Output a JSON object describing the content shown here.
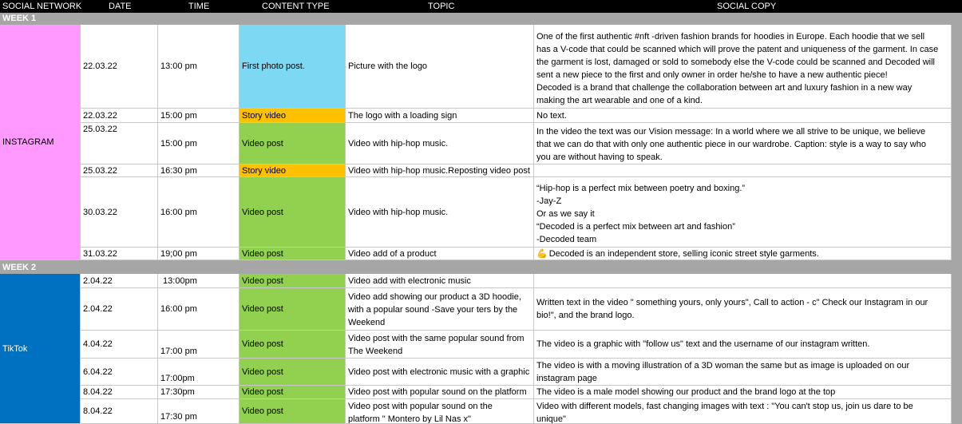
{
  "headers": {
    "network": "SOCIAL NETWORK",
    "date": "DATE",
    "time": "TIME",
    "content_type": "CONTENT TYPE",
    "topic": "TOPIC",
    "copy": "SOCIAL COPY"
  },
  "week1": "WEEK 1",
  "week2": "WEEK 2",
  "instagram": {
    "network": "INSTAGRAM",
    "rows": [
      {
        "date": "22.03.22",
        "time": "13:00 pm",
        "type": "First photo post.",
        "topic": "Picture with the logo",
        "copy": [
          "One of the first authentic #nft -driven fashion brands for hoodies in Europe. Each hoodie that we sell",
          "has a V-code that could be scanned which will prove the patent and uniqueness of the garment. In case",
          "the garment is lost, damaged or sold to somebody else the V-code could be scanned and Decoded will",
          "sent a new piece to the first and only owner in order he/she to have a new authentic piece!",
          "Decoded is a brand that challenge the collaboration between art and luxury fashion in a new way",
          "making the art wearable and one of a kind."
        ]
      },
      {
        "date": "22.03.22",
        "time": "15:00 pm",
        "type": "Story video",
        "topic": "The logo with a loading sign",
        "copy": [
          " No text."
        ]
      },
      {
        "date": "25.03.22",
        "time": "15:00 pm",
        "type": "Video post",
        "topic": "Video with hip-hop music.",
        "copy": [
          "In the video the text was our Vision message: In a world where we all strive to be unique, we believe",
          "that we can do that with only one authentic piece in our wardrobe. Caption: style is a way to say who",
          "you are without having to speak."
        ]
      },
      {
        "date": "25.03.22",
        "time": "16:30 pm",
        "type": "Story  video",
        "topic": "Video with hip-hop music.Reposting video post",
        "copy": [
          ""
        ]
      },
      {
        "date": "30.03.22",
        "time": "16:00 pm",
        "type": "Video post",
        "topic": "Video with hip-hop music.",
        "copy": [
          "“Hip-hop is a perfect mix between poetry and boxing.”",
          "-Jay-Z",
          "Or as we say it",
          "“Decoded is a perfect mix between art and fashion”",
          "-Decoded team"
        ]
      },
      {
        "date": "31.03.22",
        "time": "19;00 pm",
        "type": "Video post",
        "topic": "Video add of a product",
        "copy": [
          "Decoded is an independent store, selling iconic street style garments."
        ]
      }
    ]
  },
  "tiktok": {
    "network": "TikTok",
    "rows": [
      {
        "date": "2.04.22",
        "time": " 13:00pm",
        "type": "Video post",
        "topic": [
          "Video add with electronic music"
        ],
        "copy": [
          ""
        ]
      },
      {
        "date": "2.04.22",
        "time": "16:00 pm",
        "type": "Video post",
        "topic": [
          "Video add showing our product a 3D hoodie,",
          "with a popular sound -Save your ters by the",
          "Weekend"
        ],
        "copy": [
          "Written text in the video \" something yours, only yours\", Call to action - c\" Check our Instagram in our",
          "bio!\", and the brand logo."
        ]
      },
      {
        "date": "4.04.22",
        "time": "17:00 pm",
        "type": "Video post",
        "topic": [
          "Video post with the same popular sound from",
          "The Weekend"
        ],
        "copy": [
          "The video is a graphic with \"follow us\" text  and the username of our instagram written."
        ]
      },
      {
        "date": "6.04.22",
        "time": "17:00pm",
        "type": "Video post",
        "topic": [
          "Video post with electronic music with a graphic"
        ],
        "copy": [
          "The video is with a moving illustration of a 3D woman the same but as image is uploaded on our",
          "instagram page"
        ]
      },
      {
        "date": "8.04.22",
        "time": "17:30pm",
        "type": "Video post",
        "topic": [
          "Video post with popular sound on the platform"
        ],
        "copy": [
          "The video is a male model showing our product and the brand logo at the top"
        ]
      },
      {
        "date": "8.04.22",
        "time": "17:30 pm",
        "type": "Video post",
        "topic": [
          "Video post with popular sound on the",
          "platform \" Montero by Lil Nas x\""
        ],
        "copy": [
          "Video with different models, fast changing images with text : \"You can't stop us, join us dare to be",
          "unique\""
        ]
      }
    ]
  },
  "colors": {
    "instagram": "#ff99ff",
    "tiktok": "#0070c0",
    "first_photo": "#7dd9f3",
    "story": "#ffc000",
    "video_post": "#92d050",
    "header": "#000000",
    "week_bar": "#a6a6a6"
  },
  "icons": {
    "bicep": "flexed-biceps-icon"
  }
}
